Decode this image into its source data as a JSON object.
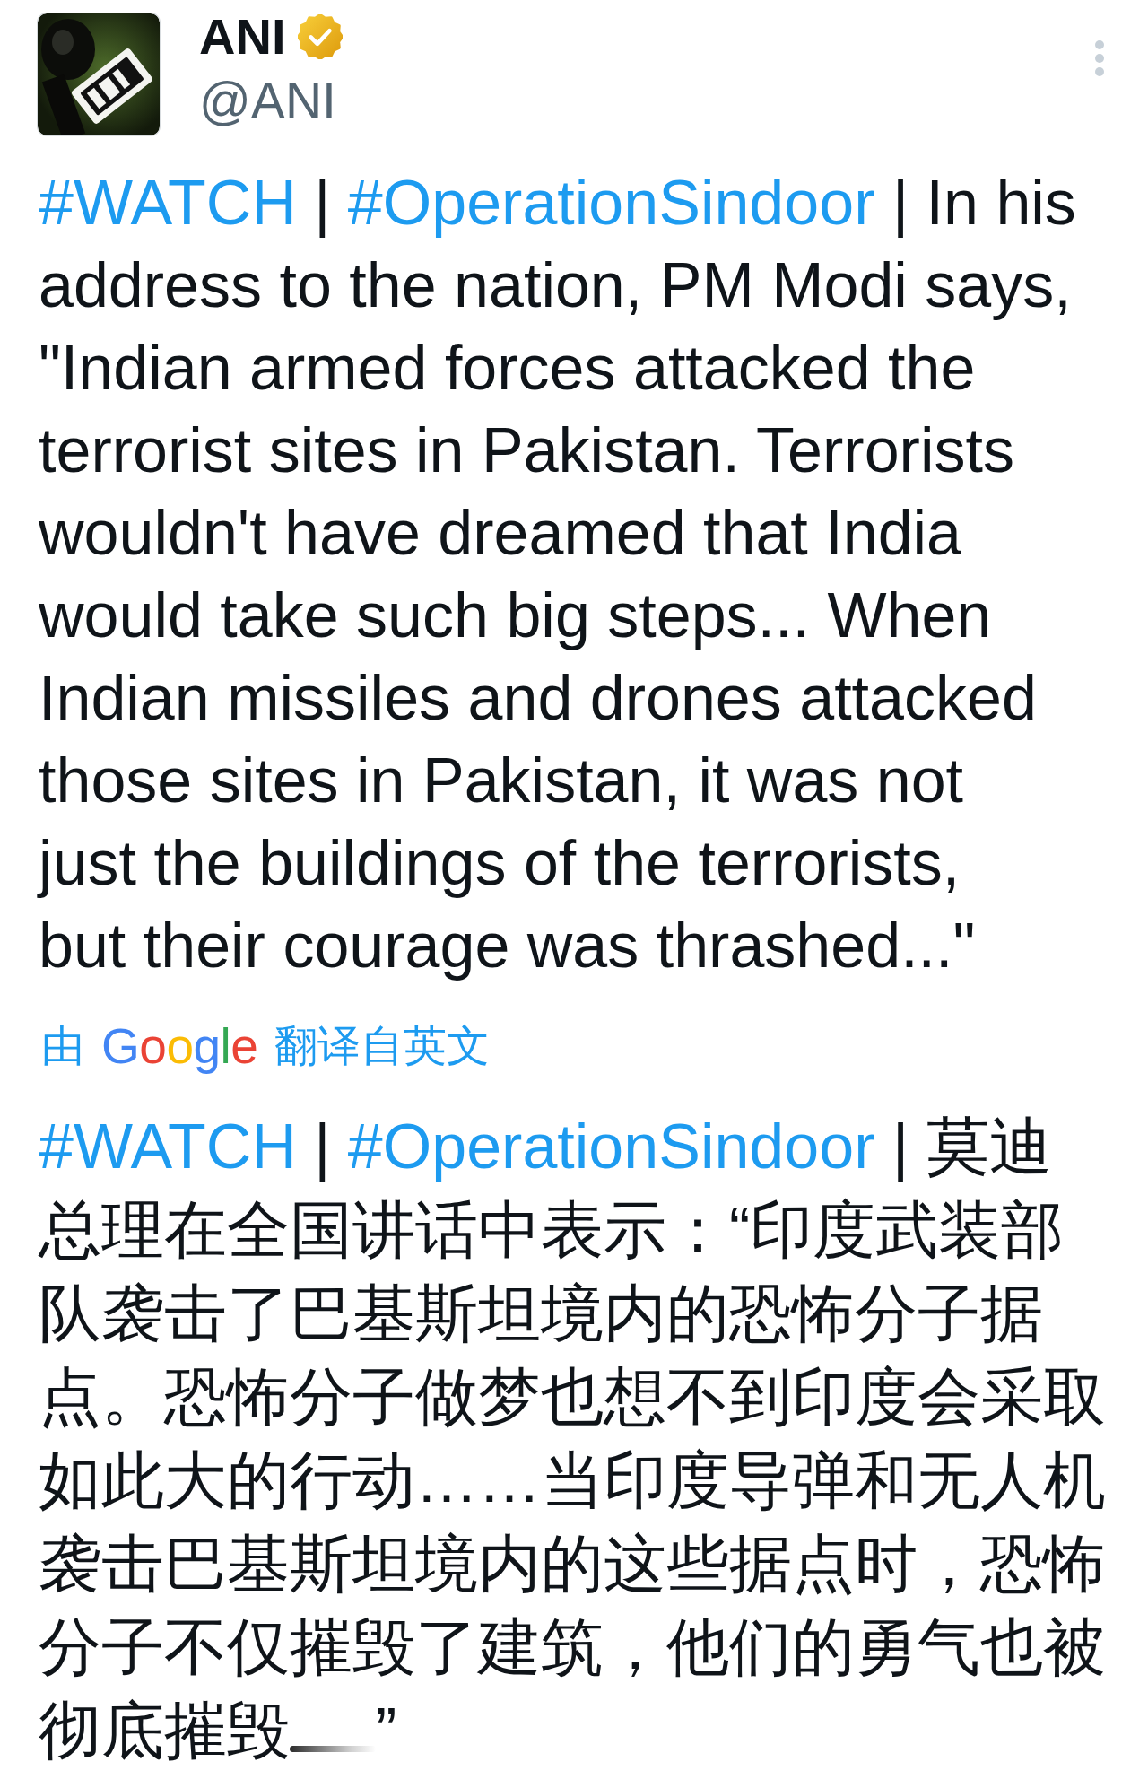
{
  "author": {
    "display_name": "ANI",
    "handle": "@ANI",
    "verified": true
  },
  "tweet": {
    "lines": [
      [
        {
          "kind": "hashtag",
          "text": "#WATCH"
        },
        {
          "kind": "text",
          "text": " | "
        },
        {
          "kind": "hashtag",
          "text": "#OperationSindoor"
        },
        {
          "kind": "text",
          "text": " | In his"
        }
      ],
      [
        {
          "kind": "text",
          "text": "address to the nation, PM Modi says,"
        }
      ],
      [
        {
          "kind": "text",
          "text": "\"Indian armed forces attacked the"
        }
      ],
      [
        {
          "kind": "text",
          "text": "terrorist sites in Pakistan. Terrorists"
        }
      ],
      [
        {
          "kind": "text",
          "text": "wouldn't have dreamed that India"
        }
      ],
      [
        {
          "kind": "text",
          "text": "would take such big steps... When"
        }
      ],
      [
        {
          "kind": "text",
          "text": "Indian missiles and drones attacked"
        }
      ],
      [
        {
          "kind": "text",
          "text": "those sites in Pakistan, it was not"
        }
      ],
      [
        {
          "kind": "text",
          "text": "just the buildings of the terrorists,"
        }
      ],
      [
        {
          "kind": "text",
          "text": "but their courage was thrashed...\""
        }
      ]
    ]
  },
  "translation_attribution": {
    "prefix": "由",
    "logo": "Google",
    "suffix": "翻译自英文"
  },
  "translated_tweet": {
    "lines": [
      [
        {
          "kind": "hashtag",
          "text": "#WATCH"
        },
        {
          "kind": "text",
          "text": " | "
        },
        {
          "kind": "hashtag",
          "text": "#OperationSindoor"
        },
        {
          "kind": "text",
          "text": " | 莫迪"
        }
      ],
      [
        {
          "kind": "text",
          "text": "总理在全国讲话中表示：“印度武装部"
        }
      ],
      [
        {
          "kind": "text",
          "text": "队袭击了巴基斯坦境内的恐怖分子据"
        }
      ],
      [
        {
          "kind": "text",
          "text": "点。恐怖分子做梦也想不到印度会采取"
        }
      ],
      [
        {
          "kind": "text",
          "text": "如此大的行动……当印度导弹和无人机"
        }
      ],
      [
        {
          "kind": "text",
          "text": "袭击巴基斯坦境内的这些据点时，恐怖"
        }
      ],
      [
        {
          "kind": "text",
          "text": "分子不仅摧毁了建筑，他们的勇气也被"
        }
      ],
      [
        {
          "kind": "text",
          "text": "彻底摧毁"
        },
        {
          "kind": "smudge"
        },
        {
          "kind": "text",
          "text": "”"
        }
      ]
    ]
  }
}
